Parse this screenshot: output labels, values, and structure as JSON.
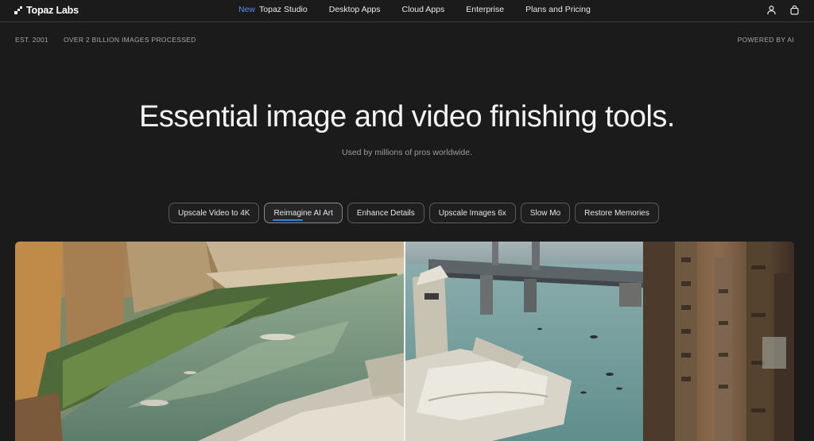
{
  "nav": {
    "logo": "Topaz Labs",
    "links": [
      {
        "badge": "New",
        "label": "Topaz Studio"
      },
      {
        "label": "Desktop Apps"
      },
      {
        "label": "Cloud Apps"
      },
      {
        "label": "Enterprise"
      },
      {
        "label": "Plans and Pricing"
      }
    ],
    "icons": [
      "user-icon",
      "bag-icon"
    ]
  },
  "subbar": {
    "est": "EST. 2001",
    "images": "OVER 2 BILLION IMAGES PROCESSED",
    "powered": "POWERED BY AI"
  },
  "hero": {
    "title": "Essential image and video finishing tools.",
    "subtitle": "Used by millions of pros worldwide."
  },
  "tabs": [
    {
      "label": "Upscale Video to 4K"
    },
    {
      "label": "Reimagine AI Art",
      "active": true
    },
    {
      "label": "Enhance Details"
    },
    {
      "label": "Upscale Images 6x"
    },
    {
      "label": "Slow Mo"
    },
    {
      "label": "Restore Memories"
    }
  ],
  "colors": {
    "background": "#1b1b1c",
    "accent": "#3d7be8",
    "new_badge": "#5b8def"
  }
}
